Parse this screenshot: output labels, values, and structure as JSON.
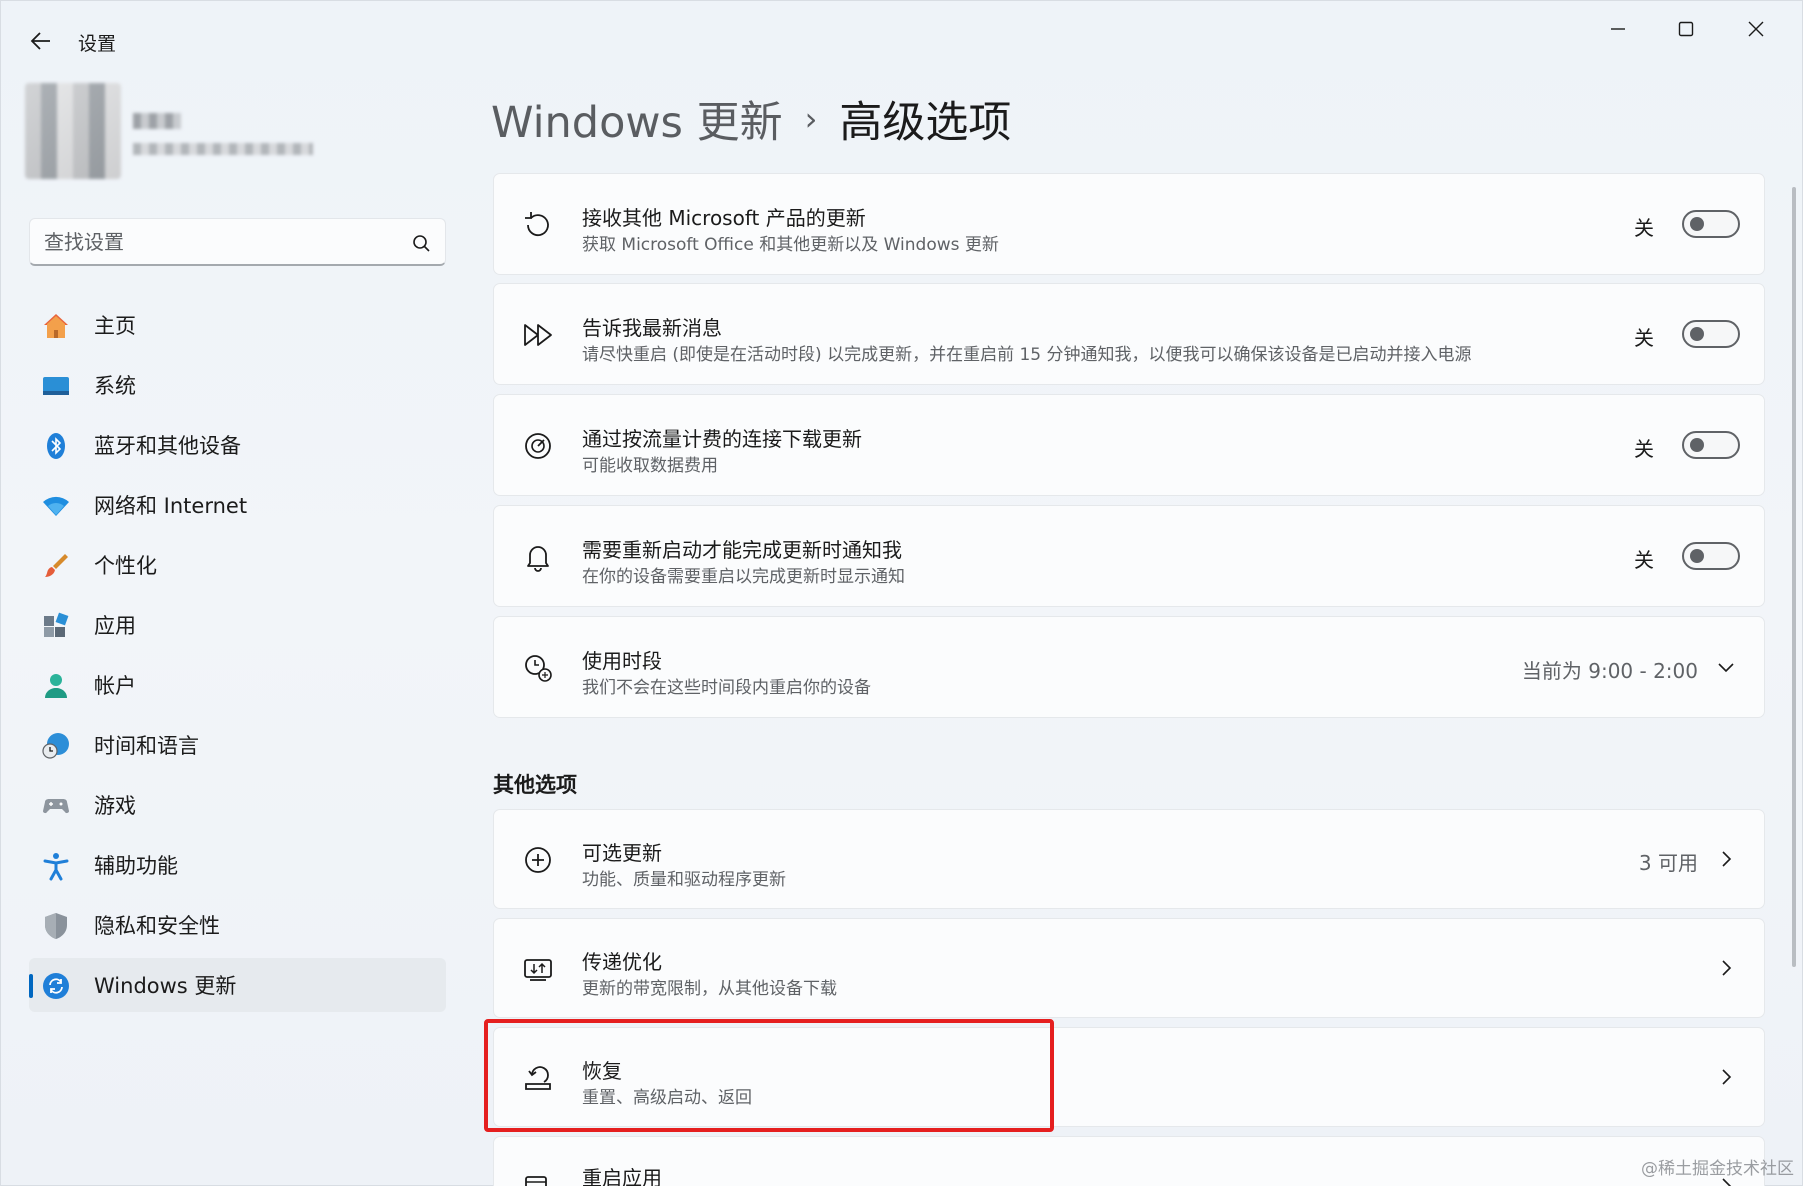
{
  "window": {
    "title": "设置",
    "controls": [
      "minimize",
      "maximize",
      "close"
    ]
  },
  "search": {
    "placeholder": "查找设置",
    "value": ""
  },
  "sidebar": {
    "items": [
      {
        "label": "主页",
        "icon": "home-icon",
        "active": false
      },
      {
        "label": "系统",
        "icon": "system-icon",
        "active": false
      },
      {
        "label": "蓝牙和其他设备",
        "icon": "bluetooth-icon",
        "active": false
      },
      {
        "label": "网络和 Internet",
        "icon": "wifi-icon",
        "active": false
      },
      {
        "label": "个性化",
        "icon": "brush-icon",
        "active": false
      },
      {
        "label": "应用",
        "icon": "apps-icon",
        "active": false
      },
      {
        "label": "帐户",
        "icon": "account-icon",
        "active": false
      },
      {
        "label": "时间和语言",
        "icon": "globe-clock-icon",
        "active": false
      },
      {
        "label": "游戏",
        "icon": "gamepad-icon",
        "active": false
      },
      {
        "label": "辅助功能",
        "icon": "accessibility-icon",
        "active": false
      },
      {
        "label": "隐私和安全性",
        "icon": "shield-icon",
        "active": false
      },
      {
        "label": "Windows 更新",
        "icon": "windows-update-icon",
        "active": true
      }
    ]
  },
  "header": {
    "parent": "Windows 更新",
    "separator": "›",
    "current": "高级选项"
  },
  "settings": [
    {
      "title": "接收其他 Microsoft 产品的更新",
      "desc": "获取 Microsoft Office 和其他更新以及 Windows 更新",
      "icon": "refresh-icon",
      "toggle_label": "关",
      "toggle_on": false
    },
    {
      "title": "告诉我最新消息",
      "desc": "请尽快重启 (即使是在活动时段) 以完成更新，并在重启前 15 分钟通知我，以便我可以确保该设备是已启动并接入电源",
      "icon": "fast-forward-icon",
      "toggle_label": "关",
      "toggle_on": false
    },
    {
      "title": "通过按流量计费的连接下载更新",
      "desc": "可能收取数据费用",
      "icon": "gauge-icon",
      "toggle_label": "关",
      "toggle_on": false
    },
    {
      "title": "需要重新启动才能完成更新时通知我",
      "desc": "在你的设备需要重启以完成更新时显示通知",
      "icon": "bell-icon",
      "toggle_label": "关",
      "toggle_on": false
    },
    {
      "title": "使用时段",
      "desc": "我们不会在这些时间段内重启你的设备",
      "icon": "active-hours-icon",
      "value": "当前为 9:00 - 2:00"
    }
  ],
  "other_options": {
    "title": "其他选项",
    "items": [
      {
        "title": "可选更新",
        "desc": "功能、质量和驱动程序更新",
        "icon": "add-circle-icon",
        "value": "3 可用"
      },
      {
        "title": "传递优化",
        "desc": "更新的带宽限制，从其他设备下载",
        "icon": "delivery-optimization-icon",
        "value": ""
      },
      {
        "title": "恢复",
        "desc": "重置、高级启动、返回",
        "icon": "recovery-icon",
        "value": ""
      },
      {
        "title": "重启应用",
        "desc": "",
        "icon": "restart-apps-icon",
        "value": ""
      }
    ]
  },
  "highlight_color": "#e51f1f",
  "accent_color": "#0067c0",
  "watermark": "@稀土掘金技术社区"
}
